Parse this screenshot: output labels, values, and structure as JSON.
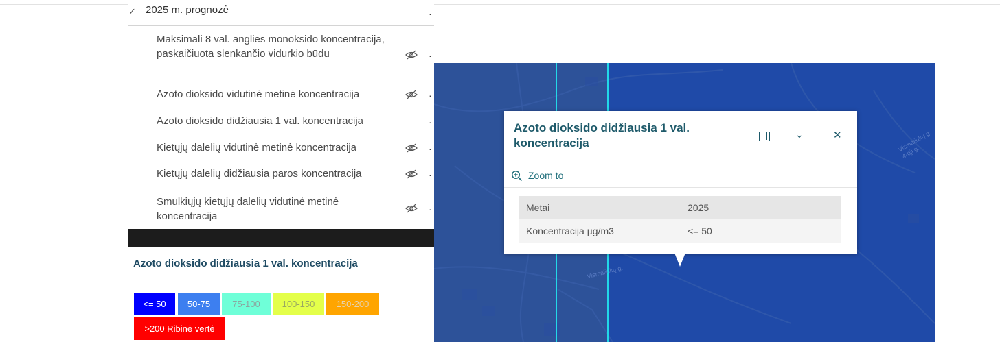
{
  "layer_list": {
    "group": {
      "label": "2025 m. prognozė",
      "checked": true
    },
    "layers": [
      {
        "label": "Maksimali 8 val. anglies monoksido koncentracija, paskaičiuota slenkančio vidurkio būdu",
        "visible": false
      },
      {
        "label": "Azoto dioksido vidutinė metinė koncentracija",
        "visible": false
      },
      {
        "label": "Azoto dioksido didžiausia 1 val. koncentracija",
        "visible": true
      },
      {
        "label": "Kietųjų dalelių vidutinė metinė koncentracija",
        "visible": false
      },
      {
        "label": "Kietųjų dalelių didžiausia paros koncentracija",
        "visible": false
      },
      {
        "label": "Smulkiųjų kietųjų dalelių vidutinė metinė koncentracija",
        "visible": false
      }
    ]
  },
  "legend": {
    "title": "Azoto dioksido didžiausia 1 val. koncentracija",
    "classes": [
      {
        "label": "<= 50",
        "color": "#0000ff"
      },
      {
        "label": "50-75",
        "color": "#3d7ff0"
      },
      {
        "label": "75-100",
        "color": "#6fffd8"
      },
      {
        "label": "100-150",
        "color": "#e4ff4a"
      },
      {
        "label": "150-200",
        "color": "#ffa500"
      },
      {
        "label": ">200 Ribinė vertė",
        "color": "#ff0000"
      }
    ]
  },
  "map": {
    "street_labels": [
      "Vismaliukų g.",
      "Vismaliukų g.\n4-oji g."
    ]
  },
  "popup": {
    "title": "Azoto dioksido didžiausia 1 val. koncentracija",
    "zoom_label": "Zoom to",
    "fields": [
      {
        "key": "Metai",
        "value": "2025"
      },
      {
        "key": "Koncentracija µg/m3",
        "value": "<= 50"
      }
    ]
  },
  "colors": {
    "accent": "#1e5a6a",
    "map_fill": "#1f4aa8",
    "boundary": "#22d8e8"
  }
}
